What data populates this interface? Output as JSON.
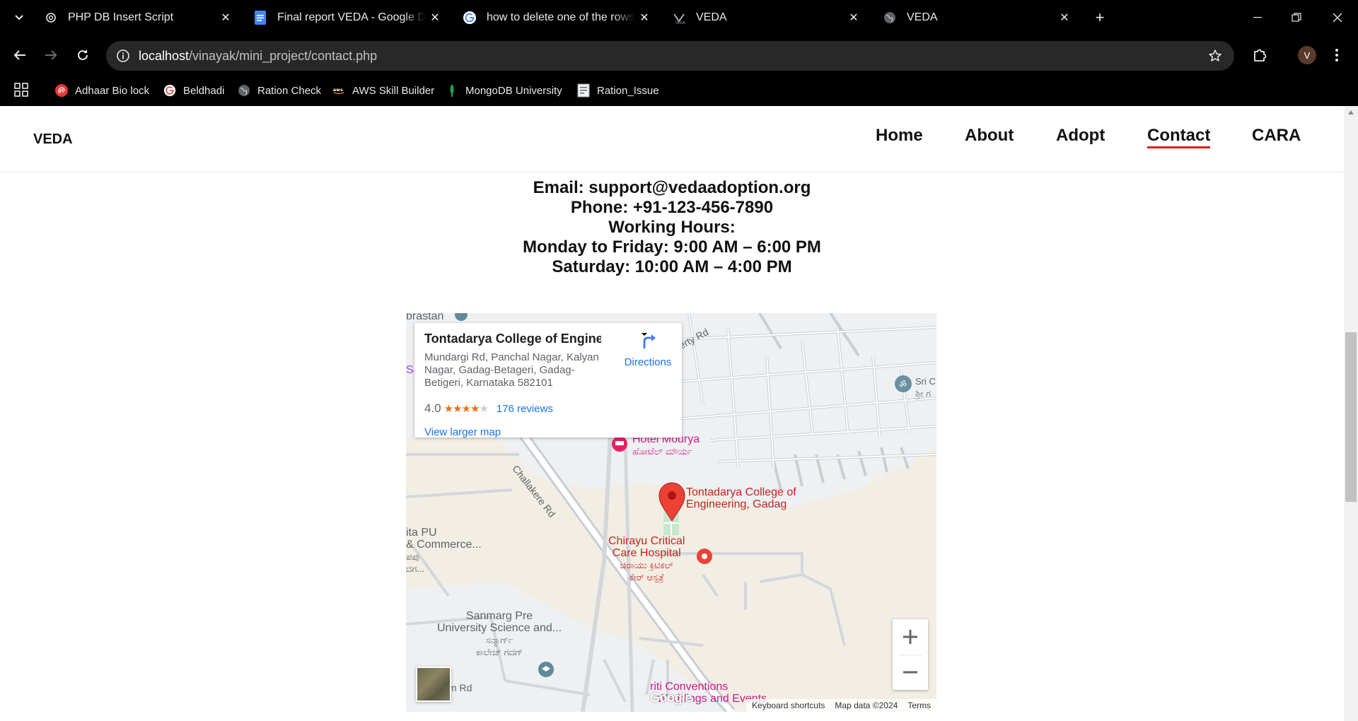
{
  "browser": {
    "tabs": [
      {
        "title": "PHP DB Insert Script",
        "icon": "openai-icon"
      },
      {
        "title": "Final report VEDA - Google Docs",
        "icon": "google-docs-icon"
      },
      {
        "title": "how to delete one of the rows in",
        "icon": "google-icon"
      },
      {
        "title": "VEDA",
        "icon": "veda-icon"
      },
      {
        "title": "VEDA",
        "icon": "globe-icon"
      }
    ],
    "url_host": "localhost",
    "url_path": "/vinayak/mini_project/contact.php",
    "profile_initial": "V",
    "bookmarks": [
      {
        "label": "Adhaar Bio lock",
        "icon": "fingerprint-icon"
      },
      {
        "label": "Beldhadi",
        "icon": "google-icon"
      },
      {
        "label": "Ration Check",
        "icon": "globe-icon"
      },
      {
        "label": "AWS Skill Builder",
        "icon": "aws-icon"
      },
      {
        "label": "MongoDB University",
        "icon": "mongodb-leaf-icon"
      },
      {
        "label": "Ration_Issue",
        "icon": "document-icon"
      }
    ]
  },
  "site": {
    "logo": "VEDA",
    "nav": [
      {
        "label": "Home",
        "active": false
      },
      {
        "label": "About",
        "active": false
      },
      {
        "label": "Adopt",
        "active": false
      },
      {
        "label": "Contact",
        "active": true
      },
      {
        "label": "CARA",
        "active": false
      }
    ],
    "accent_color": "#e0201a"
  },
  "contact": {
    "email": "Email: support@vedaadoption.org",
    "phone": "Phone: +91-123-456-7890",
    "hours_heading": "Working Hours:",
    "weekdays": "Monday to Friday: 9:00 AM – 6:00 PM",
    "saturday": "Saturday: 10:00 AM – 4:00 PM"
  },
  "map": {
    "card": {
      "title": "Tontadarya College of Engine...",
      "address": "Mundargi Rd, Panchal Nagar, Kalyan Nagar, Gadag-Betageri, Gadag-Betigeri, Karnataka 582101",
      "rating": "4.0",
      "stars": 4,
      "reviews": "176 reviews",
      "larger_map": "View larger map",
      "directions": "Directions"
    },
    "labels": {
      "brastan": "brastan",
      "liberty_rd": "erty Rd",
      "sa": "Sa",
      "sri_line1": "Sri C",
      "sri_line2": "ಶ್ರೀ ಗ",
      "hotel_en": "Hotel Mourya",
      "hotel_kn": "ಹೋಟೆಲ್ ಮೌರ್ಯ",
      "challakere": "Challakere Rd",
      "college_line1": "Tontadarya College of",
      "college_line2": "Engineering, Gadag",
      "pu_line1": "ita PU",
      "pu_line2": "& Commerce...",
      "pu_line3": "ಪಪು",
      "pu_line4": "ದಗ...",
      "chirayu_line1": "Chirayu Critical",
      "chirayu_line2": "Care Hospital",
      "chirayu_line3": "ಚಿರಾಯು ಕ್ರಿಟಿಕಲ್",
      "chirayu_line4": "ಕೇರ್ ಆಸ್ಪತ್ರೆ",
      "sanmarg_line1": "Sanmarg Pre",
      "sanmarg_line2": "University Science and...",
      "sanmarg_line3": "ಸನ್ಮಾರ್ಗ್",
      "sanmarg_line4": "ಕಾಲೇಜ್ ಗದಗ್",
      "m_rd": "m Rd",
      "conventions_line1": "riti Conventions",
      "conventions_line2": "- Weddings and Events",
      "google": "Google"
    },
    "attribution": {
      "shortcuts": "Keyboard shortcuts",
      "data": "Map data ©2024",
      "terms": "Terms"
    }
  }
}
